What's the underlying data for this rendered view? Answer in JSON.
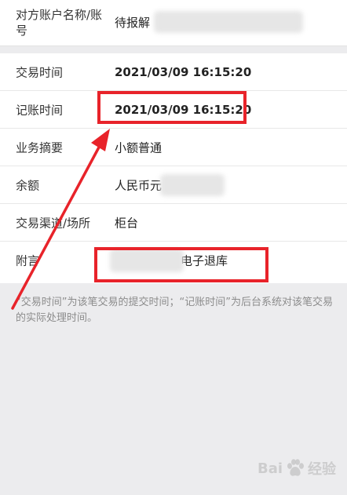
{
  "counterparty": {
    "label": "对方账户名称/账号",
    "value": "待报解"
  },
  "rows": [
    {
      "label": "交易时间",
      "value": "2021/03/09  16:15:20"
    },
    {
      "label": "记账时间",
      "value": "2021/03/09  16:15:20"
    },
    {
      "label": "业务摘要",
      "value": "小额普通"
    },
    {
      "label": "余额",
      "value": "人民币元"
    },
    {
      "label": "交易渠道/场所",
      "value": "柜台"
    },
    {
      "label": "附言",
      "value": "电子退库"
    }
  ],
  "note": "“交易时间”为该笔交易的提交时间；“记账时间”为后台系统对该笔交易的实际处理时间。",
  "watermark": {
    "brand_left": "Bai",
    "brand_right": "经验",
    "icon": "baidu-paw-icon"
  },
  "colors": {
    "annotation_red": "#e8232a",
    "background": "#ececee"
  }
}
